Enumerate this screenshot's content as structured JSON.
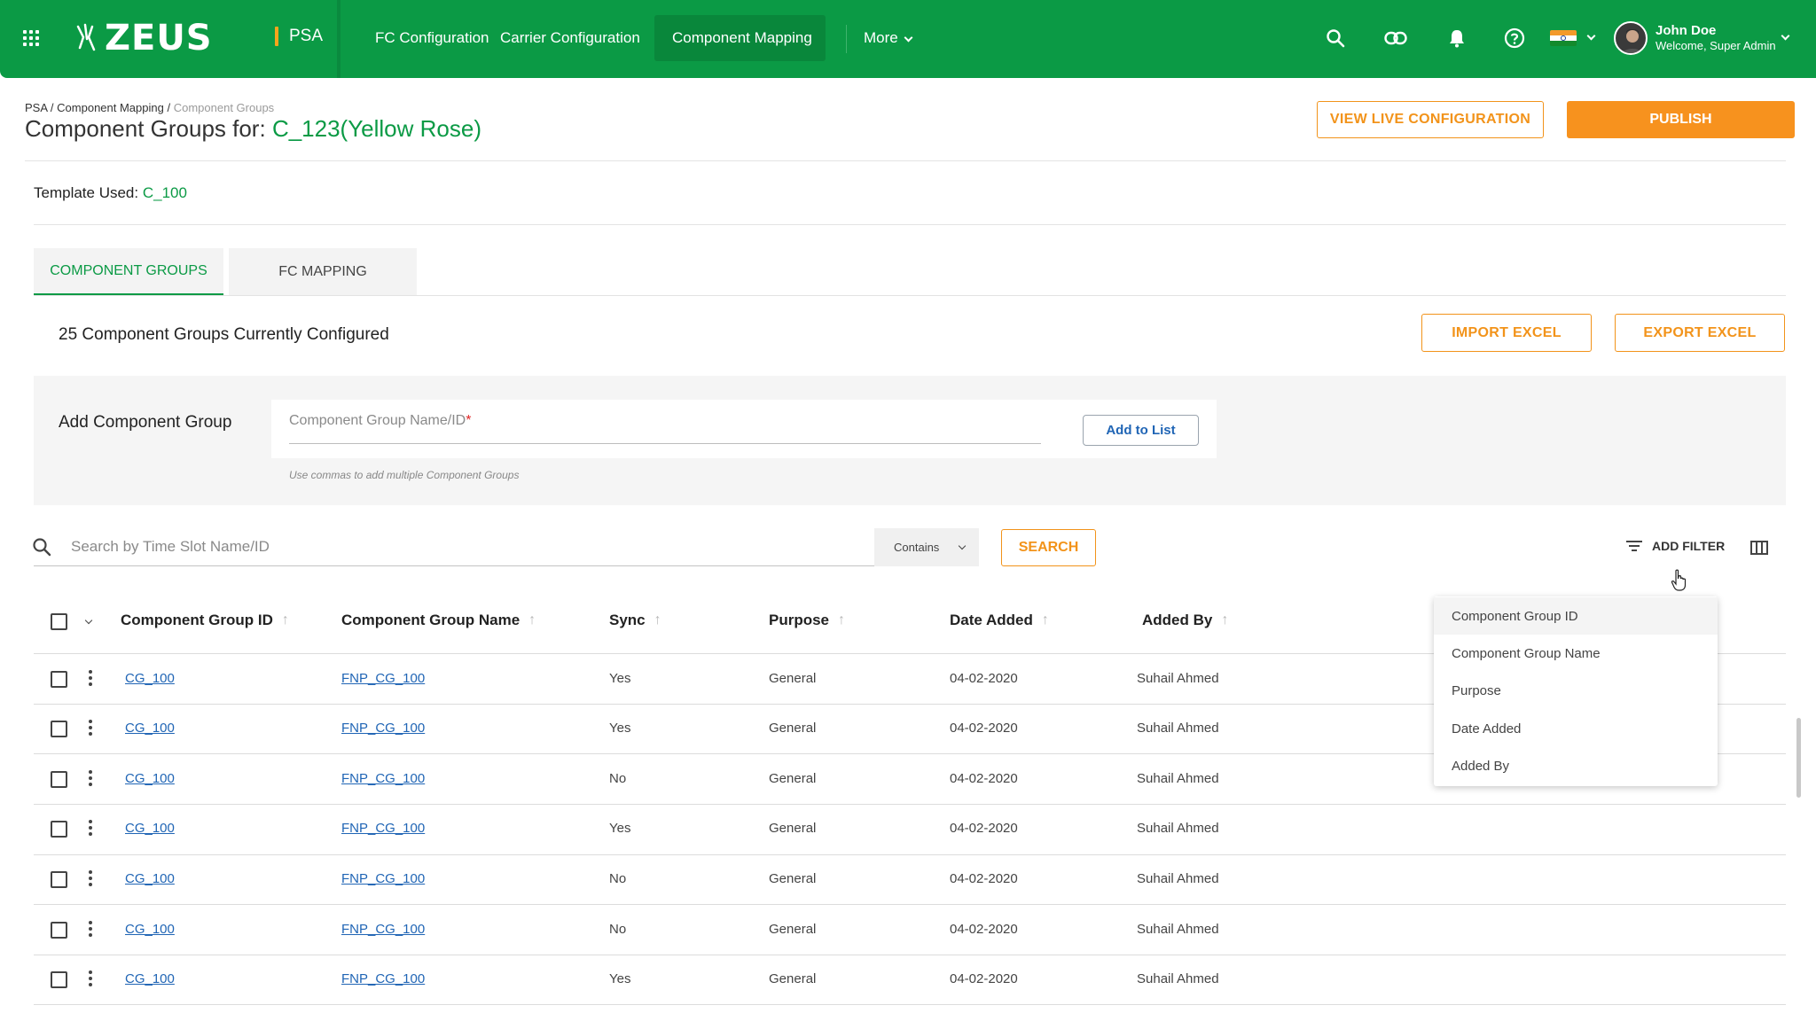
{
  "topbar": {
    "brand": "ZEUS",
    "module": "PSA",
    "nav": [
      "FC Configuration",
      "Carrier Configuration",
      "Component Mapping",
      "More"
    ],
    "user_name": "John Doe",
    "user_subtitle": "Welcome, Super Admin",
    "colors": {
      "bar": "#0b9a45",
      "active": "#09873b"
    }
  },
  "header": {
    "breadcrumb": [
      "PSA /",
      "Component Mapping",
      "/",
      "Component Groups"
    ],
    "title_prefix": "Component Groups for:",
    "title_value": "C_123(Yellow Rose)",
    "view_live_label": "VIEW LIVE CONFIGURATION",
    "publish_label": "PUBLISH"
  },
  "template": {
    "label": "Template Used:",
    "value": "C_100"
  },
  "tabs": [
    {
      "label": "COMPONENT GROUPS"
    },
    {
      "label": "FC MAPPING"
    }
  ],
  "summary": {
    "count_text": "25 Component Groups Currently Configured",
    "import_label": "IMPORT EXCEL",
    "export_label": "EXPORT EXCEL"
  },
  "add_group": {
    "label": "Add Component Group",
    "placeholder": "Component Group Name/ID",
    "required_mark": "*",
    "button_label": "Add to List",
    "hint": "Use commas to add multiple Component Groups"
  },
  "search": {
    "placeholder": "Search by Time Slot Name/ID",
    "operator": "Contains",
    "button_label": "SEARCH",
    "filter_label": "ADD FILTER"
  },
  "table": {
    "columns": [
      "Component Group ID",
      "Component Group Name",
      "Sync",
      "Purpose",
      "Date Added",
      "Added By"
    ],
    "rows": [
      {
        "id": "CG_100",
        "name": "FNP_CG_100",
        "sync": "Yes",
        "purpose": "General",
        "date": "04-02-2020",
        "by": "Suhail Ahmed"
      },
      {
        "id": "CG_100",
        "name": "FNP_CG_100",
        "sync": "Yes",
        "purpose": "General",
        "date": "04-02-2020",
        "by": "Suhail Ahmed"
      },
      {
        "id": "CG_100",
        "name": "FNP_CG_100",
        "sync": "No",
        "purpose": "General",
        "date": "04-02-2020",
        "by": "Suhail Ahmed"
      },
      {
        "id": "CG_100",
        "name": "FNP_CG_100",
        "sync": "Yes",
        "purpose": "General",
        "date": "04-02-2020",
        "by": "Suhail Ahmed"
      },
      {
        "id": "CG_100",
        "name": "FNP_CG_100",
        "sync": "No",
        "purpose": "General",
        "date": "04-02-2020",
        "by": "Suhail Ahmed"
      },
      {
        "id": "CG_100",
        "name": "FNP_CG_100",
        "sync": "No",
        "purpose": "General",
        "date": "04-02-2020",
        "by": "Suhail Ahmed"
      },
      {
        "id": "CG_100",
        "name": "FNP_CG_100",
        "sync": "Yes",
        "purpose": "General",
        "date": "04-02-2020",
        "by": "Suhail Ahmed"
      }
    ]
  },
  "filter_menu": {
    "items": [
      "Component Group ID",
      "Component Group Name",
      "Purpose",
      "Date Added",
      "Added By"
    ]
  }
}
